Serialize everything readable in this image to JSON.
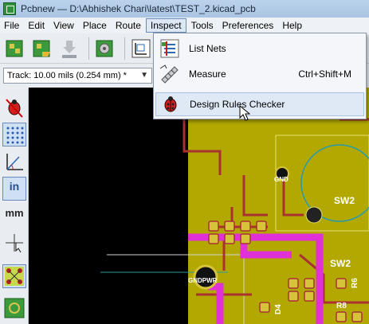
{
  "window": {
    "title": "Pcbnew — D:\\Abhishek Chari\\latest\\TEST_2.kicad_pcb"
  },
  "menubar": {
    "items": [
      "File",
      "Edit",
      "View",
      "Place",
      "Route",
      "Inspect",
      "Tools",
      "Preferences",
      "Help"
    ],
    "open_menu": "Inspect"
  },
  "track_select": {
    "value": "Track: 10.00 mils (0.254 mm) *"
  },
  "left_toolbar": {
    "units_label": "in",
    "mm_label": "mm"
  },
  "inspect_menu": {
    "items": [
      {
        "label": "List Nets",
        "shortcut": "",
        "icon": "list-nets-icon"
      },
      {
        "label": "Measure",
        "shortcut": "Ctrl+Shift+M",
        "icon": "measure-calipers-icon"
      },
      {
        "label": "Design Rules Checker",
        "shortcut": "",
        "icon": "drc-ladybug-icon"
      }
    ],
    "hovered": "Design Rules Checker"
  },
  "pcb": {
    "labels": [
      "SW2",
      "SW2",
      "GND",
      "GNDPWR",
      "R6",
      "R8",
      "D4"
    ]
  },
  "colors": {
    "board": "#b3a800",
    "copper": "#a83232",
    "pad": "#d6c33a",
    "highlight_net": "#e030d8"
  }
}
